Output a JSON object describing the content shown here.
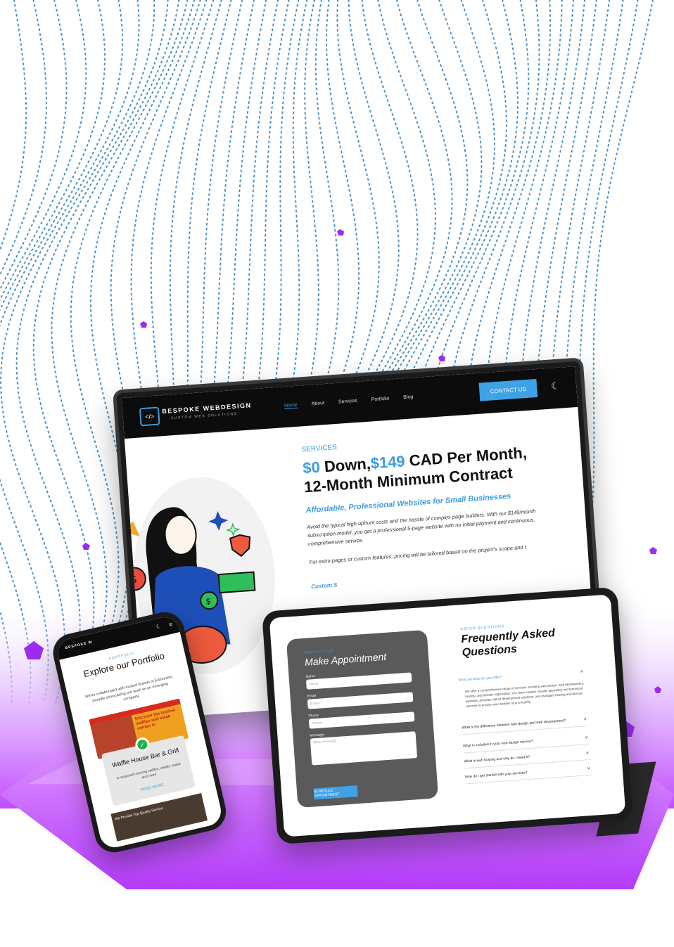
{
  "colors": {
    "accent": "#3b9de0",
    "wave": "#2f7fb8",
    "purple": "#b040ff",
    "nav_bg": "#0c0c0c"
  },
  "laptop": {
    "brand": "BESPOKE WEBDESIGN",
    "tagline": "CUSTOM WEB SOLUTIONS",
    "logo_glyph": "</>",
    "nav": [
      "Home",
      "About",
      "Services",
      "Portfolio",
      "Blog"
    ],
    "contact_button": "CONTACT US",
    "theme_icon": "moon-icon",
    "services_label": "SERVICES",
    "headline_blue1": "$0",
    "headline_mid": " Down,",
    "headline_blue2": "$149",
    "headline_rest": " CAD Per Month,",
    "headline_line2": "12-Month Minimum Contract",
    "subheadline": "Affordable, Professional Websites for Small Businesses",
    "paragraph1": "Avoid the typical high upfront costs and the hassle of complex page builders. With our $149/month subscription model, you get a professional 5-page website with no initial payment and continuous, comprehensive service.",
    "paragraph2": "For extra pages or custom features, pricing will be tailored based on the project's scope and t",
    "custom_label": "Custom S"
  },
  "tablet": {
    "contact_label": "CONTACT US",
    "appointment_title": "Make Appointment",
    "fields": [
      {
        "label": "Name",
        "placeholder": "Name"
      },
      {
        "label": "Email",
        "placeholder": "Email"
      },
      {
        "label": "Phone",
        "placeholder": "Phone"
      },
      {
        "label": "Message",
        "placeholder": "Write message"
      }
    ],
    "schedule_button": "SCHEDULE APPOINTMENT",
    "faq_label": "ASKED QUESTIONS",
    "faq_title": "Frequently Asked Questions",
    "faq_items": [
      "What services do you offer?",
      "What is the difference between web design and web development?",
      "What is included in your web design service?",
      "What is web hosting and why do I need it?",
      "How do I get started with your services?"
    ],
    "faq_answer": "We offer a comprehensive range of services including web design, web development, hosting, and domain registration. Our team creates visually appealing and functional websites, provides robust development solutions, and manages hosting and domain services to ensure your website runs smoothly."
  },
  "phone": {
    "brand": "BESPOKE W",
    "portfolio_label": "PORTFOLIO",
    "title": "Explore our Portfolio",
    "description": "We've collaborated with trusted brands in Edmonton, proudly showcasing our work as an emerging company.",
    "shot_text": "Discover the tastiest waffles and steak combo in",
    "card_title": "Waffle House Bar & Grill",
    "card_desc": "A restaurant serving waffles, steaks, salad and more.",
    "read_more": "READ MORE",
    "bottom_text": "We Provide Top Quality Service"
  }
}
